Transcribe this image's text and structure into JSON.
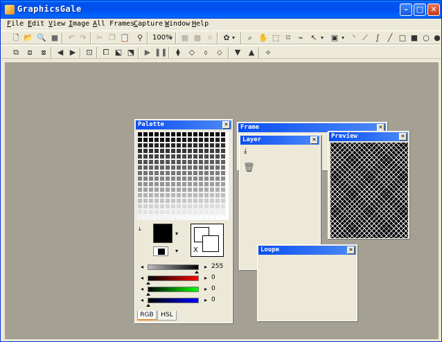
{
  "window": {
    "title": "GraphicsGale"
  },
  "menu": [
    "File",
    "Edit",
    "View",
    "Image",
    "All Frames",
    "Capture",
    "Window",
    "Help"
  ],
  "toolbar": {
    "zoom": "100%"
  },
  "panels": {
    "palette": {
      "title": "Palette",
      "rgb_value_top": "255",
      "r": "0",
      "g": "0",
      "b": "0",
      "tabs": [
        "RGB",
        "HSL"
      ],
      "swap_label": "X"
    },
    "frame": {
      "title": "Frame"
    },
    "layer": {
      "title": "Layer"
    },
    "preview": {
      "title": "Preview"
    },
    "loupe": {
      "title": "Loupe"
    }
  }
}
